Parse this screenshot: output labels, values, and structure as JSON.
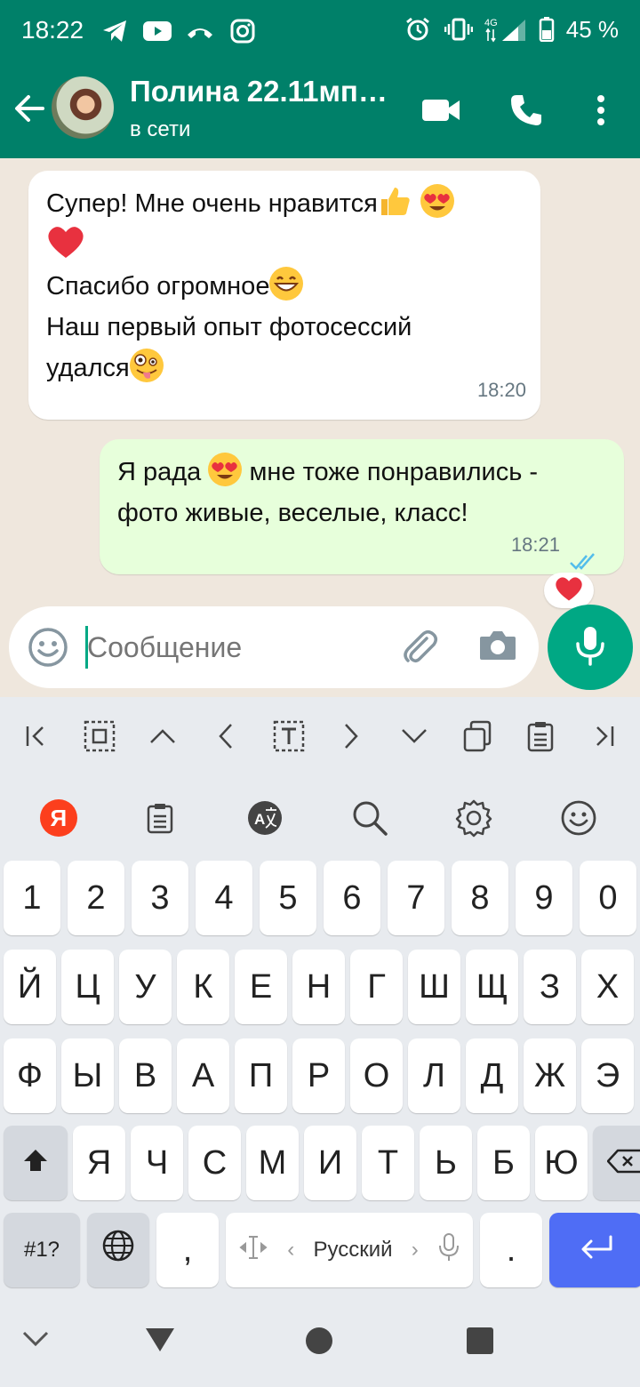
{
  "status_bar": {
    "time": "18:22",
    "network": "4G",
    "battery": "45 %"
  },
  "contact": {
    "name": "Полина 22.11мп…",
    "status": "в сети"
  },
  "messages": [
    {
      "direction": "incoming",
      "lines": [
        "Супер! Мне очень нравится",
        "",
        "Спасибо огромное",
        "Наш первый опыт фотосессий",
        "удался"
      ],
      "time": "18:20"
    },
    {
      "direction": "outgoing",
      "lines": [
        "Я рада",
        "мне тоже понравились -",
        "фото живые, веселые, класс!"
      ],
      "time": "18:21",
      "status": "read"
    }
  ],
  "composer": {
    "placeholder": "Сообщение"
  },
  "keyboard": {
    "row_numbers": [
      "1",
      "2",
      "3",
      "4",
      "5",
      "6",
      "7",
      "8",
      "9",
      "0"
    ],
    "row1": [
      "Й",
      "Ц",
      "У",
      "К",
      "Е",
      "Н",
      "Г",
      "Ш",
      "Щ",
      "З",
      "Х"
    ],
    "row2": [
      "Ф",
      "Ы",
      "В",
      "А",
      "П",
      "Р",
      "О",
      "Л",
      "Д",
      "Ж",
      "Э"
    ],
    "row3": [
      "Я",
      "Ч",
      "С",
      "М",
      "И",
      "Т",
      "Ь",
      "Б",
      "Ю"
    ],
    "symbols_key": "#1?",
    "comma": ",",
    "period": ".",
    "language": "Русский",
    "yandex_label": "Я"
  },
  "colors": {
    "header": "#008069",
    "accent": "#00a884",
    "outgoing_bubble": "#e7ffdb",
    "enter_key": "#4f6df5"
  }
}
